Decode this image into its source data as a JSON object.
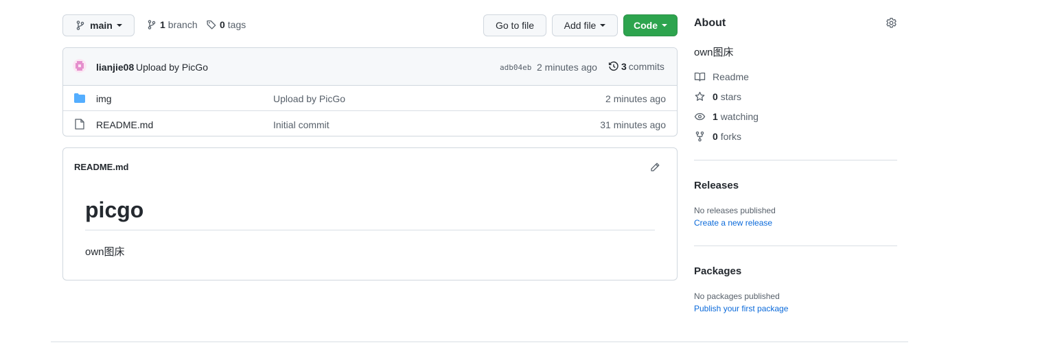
{
  "toolbar": {
    "branch_button": "main",
    "branch_count": "1",
    "branch_label": "branch",
    "tag_count": "0",
    "tag_label": "tags",
    "go_to_file": "Go to file",
    "add_file": "Add file",
    "code": "Code"
  },
  "commit": {
    "author": "lianjie08",
    "message": "Upload by PicGo",
    "sha": "adb04eb",
    "time": "2 minutes ago",
    "commit_count": "3",
    "commit_label": "commits"
  },
  "files": [
    {
      "icon": "folder-icon",
      "name": "img",
      "message": "Upload by PicGo",
      "time": "2 minutes ago"
    },
    {
      "icon": "file-icon",
      "name": "README.md",
      "message": "Initial commit",
      "time": "31 minutes ago"
    }
  ],
  "readme": {
    "filename": "README.md",
    "heading": "picgo",
    "body": "own图床"
  },
  "about": {
    "title": "About",
    "description": "own图床",
    "readme_label": "Readme",
    "stars_count": "0",
    "stars_label": "stars",
    "watching_count": "1",
    "watching_label": "watching",
    "forks_count": "0",
    "forks_label": "forks"
  },
  "releases": {
    "title": "Releases",
    "empty": "No releases published",
    "link": "Create a new release"
  },
  "packages": {
    "title": "Packages",
    "empty": "No packages published",
    "link": "Publish your first package"
  },
  "colors": {
    "accent_green": "#2da44e",
    "link_blue": "#0969da",
    "folder_blue": "#54aeff",
    "border": "#d0d7de"
  }
}
